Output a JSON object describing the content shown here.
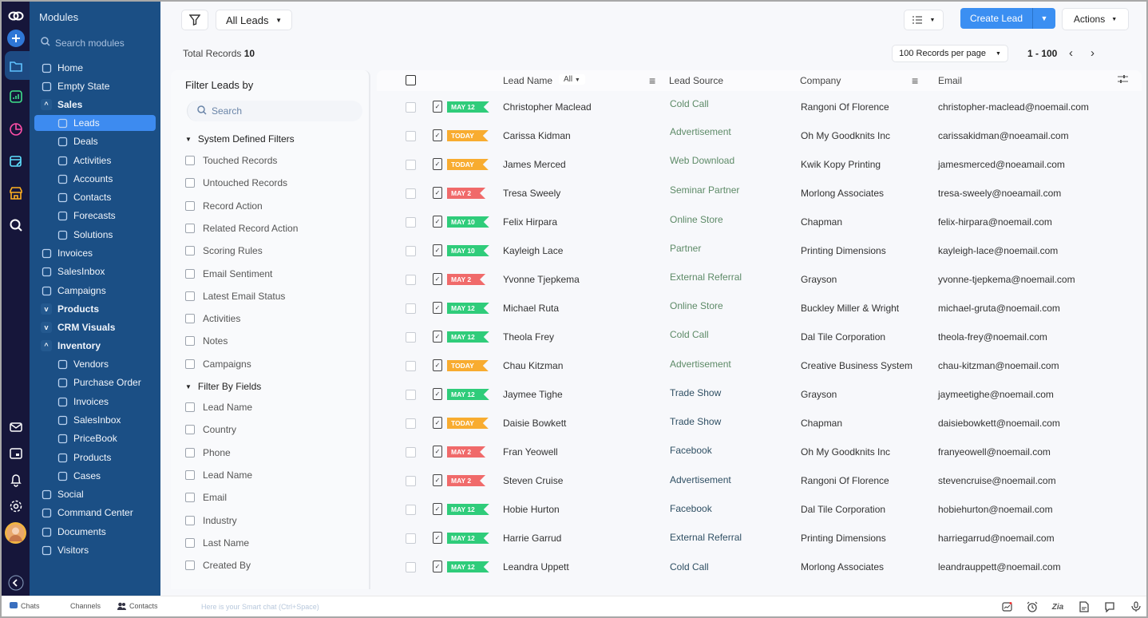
{
  "colors": {
    "rail_bg": "#16163a",
    "modules_bg": "#1b4f85",
    "active_item": "#3d8bf0",
    "primary_button": "#3b8ff2",
    "tag_green": "#2fcc7a",
    "tag_orange": "#f8ac30",
    "tag_red": "#f06a6a",
    "source_green": "#5d8a67",
    "source_dark": "#2f4f63"
  },
  "rail": {
    "icons": [
      "app-logo",
      "create",
      "modules-folder",
      "analytics",
      "reports-pie",
      "planner",
      "marketplace",
      "search",
      "mail",
      "calendar",
      "notifications",
      "settings",
      "user-avatar",
      "collapse"
    ]
  },
  "modules": {
    "title": "Modules",
    "search_placeholder": "Search modules",
    "items": [
      {
        "label": "Home",
        "icon": "home-icon",
        "level": 0
      },
      {
        "label": "Empty State",
        "icon": "grid-icon",
        "level": 0
      },
      {
        "label": "Sales",
        "icon": "chevron-up",
        "level": 0,
        "group": true
      },
      {
        "label": "Leads",
        "icon": "target-icon",
        "level": 1,
        "active": true
      },
      {
        "label": "Deals",
        "icon": "wallet-icon",
        "level": 1
      },
      {
        "label": "Activities",
        "icon": "activity-icon",
        "level": 1
      },
      {
        "label": "Accounts",
        "icon": "building-icon",
        "level": 1
      },
      {
        "label": "Contacts",
        "icon": "contact-icon",
        "level": 1
      },
      {
        "label": "Forecasts",
        "icon": "forecast-icon",
        "level": 1
      },
      {
        "label": "Solutions",
        "icon": "bulb-icon",
        "level": 1
      },
      {
        "label": "Invoices",
        "icon": "invoice-icon",
        "level": 0
      },
      {
        "label": "SalesInbox",
        "icon": "inbox-icon",
        "level": 0
      },
      {
        "label": "Campaigns",
        "icon": "megaphone-icon",
        "level": 0
      },
      {
        "label": "Products",
        "icon": "chevron-down",
        "level": 0,
        "group": true
      },
      {
        "label": "CRM Visuals",
        "icon": "chevron-down",
        "level": 0,
        "group": true
      },
      {
        "label": "Inventory",
        "icon": "chevron-up",
        "level": 0,
        "group": true
      },
      {
        "label": "Vendors",
        "icon": "store-icon",
        "level": 1
      },
      {
        "label": "Purchase Order",
        "icon": "cart-icon",
        "level": 1
      },
      {
        "label": "Invoices",
        "icon": "invoice-icon",
        "level": 1
      },
      {
        "label": "SalesInbox",
        "icon": "inbox-icon",
        "level": 1
      },
      {
        "label": "PriceBook",
        "icon": "tag-icon",
        "level": 1
      },
      {
        "label": "Products",
        "icon": "grid-icon",
        "level": 1
      },
      {
        "label": "Cases",
        "icon": "ticket-icon",
        "level": 1
      },
      {
        "label": "Social",
        "icon": "social-icon",
        "level": 0
      },
      {
        "label": "Command Center",
        "icon": "command-icon",
        "level": 0
      },
      {
        "label": "Documents",
        "icon": "documents-icon",
        "level": 0
      },
      {
        "label": "Visitors",
        "icon": "visitors-icon",
        "level": 0
      }
    ]
  },
  "toolbar": {
    "view_select": "All Leads",
    "create_label": "Create Lead",
    "actions_label": "Actions"
  },
  "records": {
    "total_label": "Total Records",
    "total_value": "10",
    "per_page": "100 Records per page",
    "range": "1 - 100"
  },
  "filters": {
    "title": "Filter Leads by",
    "search_placeholder": "Search",
    "system_title": "System Defined Filters",
    "system_items": [
      "Touched Records",
      "Untouched Records",
      "Record Action",
      "Related Record Action",
      "Scoring Rules",
      "Email Sentiment",
      "Latest Email Status",
      "Activities",
      "Notes",
      "Campaigns"
    ],
    "fields_title": "Filter By Fields",
    "field_items": [
      "Lead Name",
      "Country",
      "Phone",
      "Lead Name",
      "Email",
      "Industry",
      "Last Name",
      "Created By"
    ]
  },
  "table": {
    "columns": {
      "lead_name": "Lead Name",
      "lead_name_filter": "All",
      "lead_source": "Lead Source",
      "company": "Company",
      "email": "Email"
    },
    "rows": [
      {
        "tag": "MAY 12",
        "tag_color": "green",
        "name": "Christopher Maclead",
        "source": "Cold Call",
        "source_tone": "green",
        "company": "Rangoni Of Florence",
        "email": "christopher-maclead@noemail.com"
      },
      {
        "tag": "TODAY",
        "tag_color": "orange",
        "name": "Carissa Kidman",
        "source": "Advertisement",
        "source_tone": "green",
        "company": "Oh My Goodknits Inc",
        "email": "carissakidman@noeamail.com"
      },
      {
        "tag": "TODAY",
        "tag_color": "orange",
        "name": "James Merced",
        "source": "Web Download",
        "source_tone": "green",
        "company": "Kwik Kopy Printing",
        "email": "jamesmerced@noeamail.com"
      },
      {
        "tag": "MAY 2",
        "tag_color": "red",
        "name": "Tresa Sweely",
        "source": "Seminar Partner",
        "source_tone": "green",
        "company": "Morlong  Associates",
        "email": "tresa-sweely@noeamail.com"
      },
      {
        "tag": "MAY 10",
        "tag_color": "green",
        "name": "Felix Hirpara",
        "source": "Online Store",
        "source_tone": "green",
        "company": "Chapman",
        "email": "felix-hirpara@noemail.com"
      },
      {
        "tag": "MAY 10",
        "tag_color": "green",
        "name": "Kayleigh Lace",
        "source": "Partner",
        "source_tone": "green",
        "company": "Printing Dimensions",
        "email": "kayleigh-lace@noemail.com"
      },
      {
        "tag": "MAY 2",
        "tag_color": "red",
        "name": "Yvonne Tjepkema",
        "source": "External Referral",
        "source_tone": "green",
        "company": "Grayson",
        "email": "yvonne-tjepkema@noemail.com"
      },
      {
        "tag": "MAY 12",
        "tag_color": "green",
        "name": "Michael Ruta",
        "source": "Online Store",
        "source_tone": "green",
        "company": "Buckley Miller & Wright",
        "email": "michael-gruta@noemail.com"
      },
      {
        "tag": "MAY 12",
        "tag_color": "green",
        "name": "Theola Frey",
        "source": "Cold Call",
        "source_tone": "green",
        "company": "Dal Tile Corporation",
        "email": "theola-frey@noemail.com"
      },
      {
        "tag": "TODAY",
        "tag_color": "orange",
        "name": "Chau Kitzman",
        "source": "Advertisement",
        "source_tone": "green",
        "company": "Creative Business System",
        "email": "chau-kitzman@noemail.com"
      },
      {
        "tag": "MAY 12",
        "tag_color": "green",
        "name": "Jaymee Tighe",
        "source": "Trade Show",
        "source_tone": "dark",
        "company": "Grayson",
        "email": "jaymeetighe@noemail.com"
      },
      {
        "tag": "TODAY",
        "tag_color": "orange",
        "name": "Daisie Bowkett",
        "source": "Trade Show",
        "source_tone": "dark",
        "company": "Chapman",
        "email": "daisiebowkett@noemail.com"
      },
      {
        "tag": "MAY 2",
        "tag_color": "red",
        "name": "Fran Yeowell",
        "source": "Facebook",
        "source_tone": "dark",
        "company": "Oh My Goodknits Inc",
        "email": "franyeowell@noemail.com"
      },
      {
        "tag": "MAY 2",
        "tag_color": "red",
        "name": "Steven Cruise",
        "source": "Advertisement",
        "source_tone": "dark",
        "company": "Rangoni Of Florence",
        "email": "stevencruise@noemail.com"
      },
      {
        "tag": "MAY 12",
        "tag_color": "green",
        "name": "Hobie Hurton",
        "source": "Facebook",
        "source_tone": "dark",
        "company": "Dal Tile Corporation",
        "email": "hobiehurton@noemail.com"
      },
      {
        "tag": "MAY 12",
        "tag_color": "green",
        "name": "Harrie Garrud",
        "source": "External Referral",
        "source_tone": "dark",
        "company": "Printing Dimensions",
        "email": "harriegarrud@noemail.com"
      },
      {
        "tag": "MAY 12",
        "tag_color": "green",
        "name": "Leandra Uppett",
        "source": "Cold Call",
        "source_tone": "dark",
        "company": "Morlong Associates",
        "email": "leandrauppett@noemail.com"
      }
    ]
  },
  "bottombar": {
    "chats": "Chats",
    "channels": "Channels",
    "contacts": "Contacts",
    "smart_chat": "Here is your Smart chat (Ctrl+Space)"
  }
}
